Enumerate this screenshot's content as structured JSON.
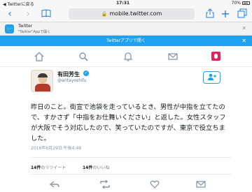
{
  "status_bar": {
    "back_label": "◀ Twitterに戻る",
    "time": "17:31",
    "battery": "70%"
  },
  "browser": {
    "url": "mobile.twitter.com",
    "back_icon": "chevron-left-icon",
    "forward_icon": "chevron-right-icon",
    "bookmarks_icon": "book-icon",
    "share_icon": "share-icon",
    "new_tab_icon": "plus-icon",
    "tabs_icon": "tabs-icon"
  },
  "app_banner": {
    "title": "Twitter",
    "subtitle": "\"Twitter\"Appで開く"
  },
  "open_in_app_bar": {
    "label": "Twitterアプリで開く"
  },
  "tweet": {
    "author_name": "有田芳生",
    "author_handle": "@aritayoshifu",
    "text": "昨日のこと。街宣で池袋を走っているとき、男性が中指を立てたので、すかさず「中指をお仕舞いください」と返した。女性スタッフが大阪でそう対応したので、笑っていたのですが、東京で役立ちました。",
    "date": "2016年6月29日 午後4:48",
    "retweets_count": "14件",
    "retweets_label": "のリツイート",
    "likes_count": "14件",
    "likes_label": "のいいね"
  },
  "colors": {
    "accent": "#1da1f2",
    "ios_blue": "#1a7ef6",
    "text": "#14171a",
    "muted": "#8899a6"
  }
}
